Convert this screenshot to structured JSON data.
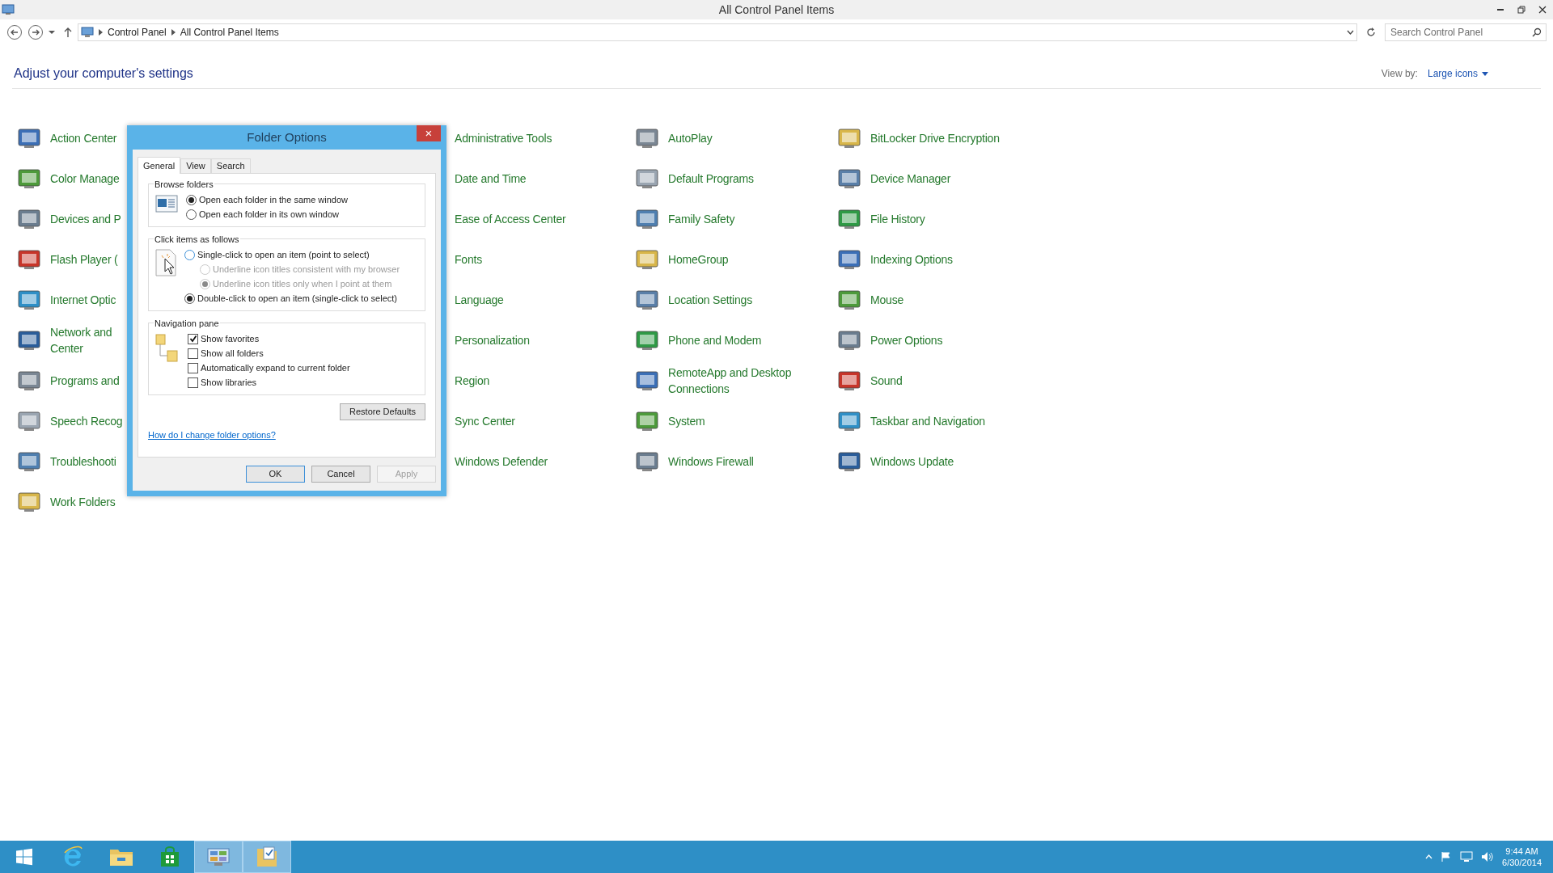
{
  "window": {
    "title": "All Control Panel Items"
  },
  "address_bar": {
    "breadcrumbs": [
      "Control Panel",
      "All Control Panel Items"
    ]
  },
  "search": {
    "placeholder": "Search Control Panel"
  },
  "heading": "Adjust your computer's settings",
  "view_by": {
    "label": "View by:",
    "value": "Large icons"
  },
  "columns": [
    {
      "items": [
        {
          "label": "Action Center"
        },
        {
          "label": "Color Manage"
        },
        {
          "label": "Devices and P"
        },
        {
          "label": "Flash Player ("
        },
        {
          "label": "Internet Optic"
        },
        {
          "label": "Network and Center"
        },
        {
          "label": "Programs and"
        },
        {
          "label": "Speech Recog"
        },
        {
          "label": "Troubleshooti"
        },
        {
          "label": "Work Folders"
        }
      ]
    },
    {
      "items": [
        {
          "label": "Administrative Tools"
        },
        {
          "label": "Date and Time"
        },
        {
          "label": "Ease of Access Center"
        },
        {
          "label": "Fonts"
        },
        {
          "label": "Language"
        },
        {
          "label": "Personalization"
        },
        {
          "label": "Region"
        },
        {
          "label": "Sync Center"
        },
        {
          "label": "Windows Defender"
        }
      ]
    },
    {
      "items": [
        {
          "label": "AutoPlay"
        },
        {
          "label": "Default Programs"
        },
        {
          "label": "Family Safety"
        },
        {
          "label": "HomeGroup"
        },
        {
          "label": "Location Settings"
        },
        {
          "label": "Phone and Modem"
        },
        {
          "label": "RemoteApp and Desktop Connections"
        },
        {
          "label": "System"
        },
        {
          "label": "Windows Firewall"
        }
      ]
    },
    {
      "items": [
        {
          "label": "BitLocker Drive Encryption"
        },
        {
          "label": "Device Manager"
        },
        {
          "label": "File History"
        },
        {
          "label": "Indexing Options"
        },
        {
          "label": "Mouse"
        },
        {
          "label": "Power Options"
        },
        {
          "label": "Sound"
        },
        {
          "label": "Taskbar and Navigation"
        },
        {
          "label": "Windows Update"
        }
      ]
    }
  ],
  "dialog": {
    "title": "Folder Options",
    "close": "×",
    "tabs": [
      {
        "label": "General",
        "selected": true
      },
      {
        "label": "View",
        "selected": false
      },
      {
        "label": "Search",
        "selected": false
      }
    ],
    "groups": [
      {
        "title": "Browse folders",
        "options": [
          {
            "kind": "radio",
            "label": "Open each folder in the same window",
            "selected": true,
            "disabled": false,
            "indent": false
          },
          {
            "kind": "radio",
            "label": "Open each folder in its own window",
            "selected": false,
            "disabled": false,
            "indent": false
          }
        ]
      },
      {
        "title": "Click items as follows",
        "options": [
          {
            "kind": "radio",
            "label": "Single-click to open an item (point to select)",
            "selected": false,
            "disabled": false,
            "indent": false
          },
          {
            "kind": "radio",
            "label": "Underline icon titles consistent with my browser",
            "selected": false,
            "disabled": true,
            "indent": true
          },
          {
            "kind": "radio",
            "label": "Underline icon titles only when I point at them",
            "selected": true,
            "disabled": true,
            "indent": true
          },
          {
            "kind": "radio",
            "label": "Double-click to open an item (single-click to select)",
            "selected": true,
            "disabled": false,
            "indent": false
          }
        ]
      },
      {
        "title": "Navigation pane",
        "options": [
          {
            "kind": "checkbox",
            "label": "Show favorites",
            "checked": true
          },
          {
            "kind": "checkbox",
            "label": "Show all folders",
            "checked": false
          },
          {
            "kind": "checkbox",
            "label": "Automatically expand to current folder",
            "checked": false
          },
          {
            "kind": "checkbox",
            "label": "Show libraries",
            "checked": false
          }
        ]
      }
    ],
    "restore_button": "Restore Defaults",
    "help_link": "How do I change folder options?",
    "buttons": [
      {
        "label": "OK",
        "disabled": false,
        "default": true
      },
      {
        "label": "Cancel",
        "disabled": false,
        "default": false
      },
      {
        "label": "Apply",
        "disabled": true,
        "default": false
      }
    ]
  },
  "taskbar": {
    "items": [
      {
        "active": false
      },
      {
        "active": false
      },
      {
        "active": false
      },
      {
        "active": false
      },
      {
        "active": true
      },
      {
        "active": true
      }
    ],
    "clock": {
      "time": "9:44 AM",
      "date": "6/30/2014"
    }
  }
}
